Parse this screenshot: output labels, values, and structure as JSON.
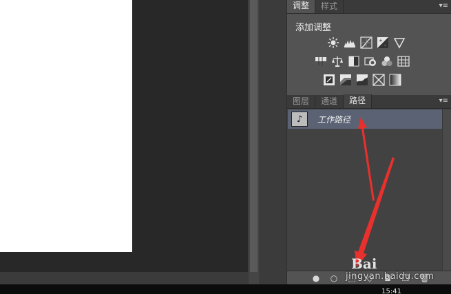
{
  "adjustments_panel": {
    "tabs": [
      {
        "label": "调整",
        "active": true
      },
      {
        "label": "样式",
        "active": false
      }
    ],
    "heading": "添加调整",
    "icons_row1": [
      "brightness-contrast-icon",
      "levels-icon",
      "curves-icon",
      "exposure-icon",
      "vibrance-icon"
    ],
    "icons_row2": [
      "hue-saturation-icon",
      "color-balance-icon",
      "black-white-icon",
      "photo-filter-icon",
      "channel-mixer-icon",
      "color-lookup-icon"
    ],
    "icons_row3": [
      "invert-icon",
      "posterize-icon",
      "threshold-icon",
      "selective-color-icon",
      "gradient-map-icon"
    ]
  },
  "paths_panel": {
    "tabs": [
      {
        "label": "图层",
        "active": false
      },
      {
        "label": "通道",
        "active": false
      },
      {
        "label": "路径",
        "active": true
      }
    ],
    "items": [
      {
        "name": "工作路径",
        "selected": true
      }
    ],
    "footer_icons": [
      "fill-path-icon",
      "stroke-path-icon",
      "load-selection-icon",
      "make-work-path-icon",
      "add-mask-icon",
      "new-path-icon",
      "delete-path-icon"
    ]
  },
  "taskbar": {
    "clock": "15:41"
  },
  "watermark": {
    "logo": "Bai",
    "text": "jingyan.baidu.com"
  },
  "colors": {
    "panel_bg": "#535353",
    "selected_row": "#5a6273",
    "annotation_arrow": "#e8302d"
  }
}
